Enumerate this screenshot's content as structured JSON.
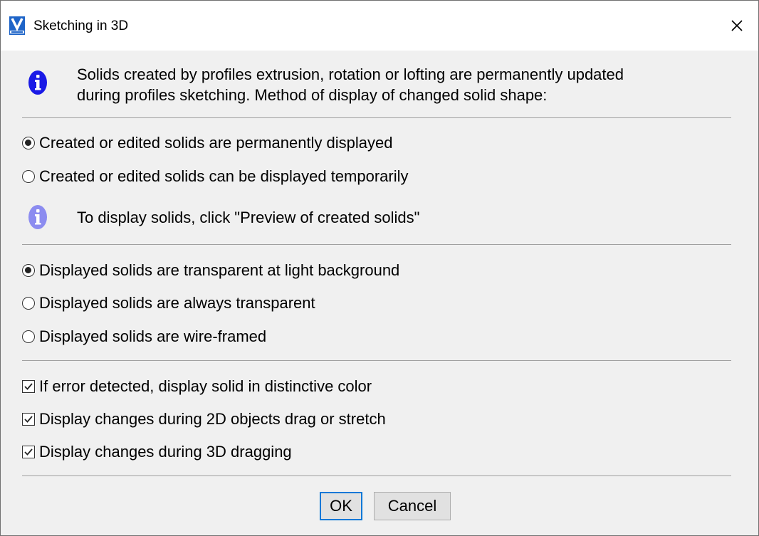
{
  "window": {
    "title": "Sketching in 3D",
    "close_symbol": "×",
    "icons": {
      "app": "varicad-app-icon",
      "close": "close-icon"
    }
  },
  "intro": {
    "line1": "Solids created by profiles extrusion, rotation or lofting are permanently updated",
    "line2": "during profiles sketching. Method of display of changed solid shape:"
  },
  "display_mode": {
    "options": [
      {
        "label": "Created or edited solids are permanently displayed",
        "checked": true
      },
      {
        "label": "Created or edited solids can be displayed temporarily",
        "checked": false
      }
    ],
    "hint": "To display solids, click \"Preview of created solids\""
  },
  "transparency": {
    "options": [
      {
        "label": "Displayed solids are transparent at light background",
        "checked": true
      },
      {
        "label": "Displayed solids are always transparent",
        "checked": false
      },
      {
        "label": "Displayed solids are wire-framed",
        "checked": false
      }
    ]
  },
  "checkboxes": [
    {
      "label": "If error detected, display solid in distinctive color",
      "checked": true
    },
    {
      "label": "Display changes during 2D objects drag or stretch",
      "checked": true
    },
    {
      "label": "Display changes during 3D dragging",
      "checked": true
    }
  ],
  "buttons": {
    "ok": "OK",
    "cancel": "Cancel"
  },
  "colors": {
    "info_primary": "#1a1ae6",
    "info_light": "#8c8cf0",
    "focus_border": "#0078d7",
    "varicad_blue": "#1e64c8"
  }
}
